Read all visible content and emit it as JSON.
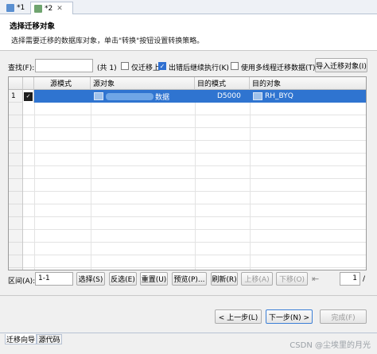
{
  "tabs": [
    {
      "label": "*1"
    },
    {
      "label": "*2",
      "close": "✕"
    }
  ],
  "header": {
    "title": "选择迁移对象",
    "description": "选择需要迁移的数据库对象，单击\"转换\"按钮设置转换策略。"
  },
  "search": {
    "label": "查找(F):",
    "value": "",
    "count": "(共 1)",
    "options": [
      {
        "label": "仅迁移上",
        "checked": false
      },
      {
        "label": "出错后继续执行(K)",
        "checked": true
      },
      {
        "label": "使用多线程迁移数据(T)",
        "checked": false
      }
    ],
    "import_button": "导入迁移对象(I)"
  },
  "table": {
    "columns": [
      "",
      "源模式",
      "源对象",
      "目的模式",
      "目的对象"
    ],
    "rows": [
      {
        "index": "1",
        "checked": true,
        "source_schema": "",
        "source_object": "数据",
        "target_schema": "D5000",
        "target_object": "RH_BYQ"
      }
    ]
  },
  "range": {
    "label": "区间(A):",
    "value": "1-1",
    "buttons": {
      "select": "选择(S)",
      "invert": "反选(E)",
      "reset": "重置(U)",
      "preview": "预览(P)...",
      "refresh": "刷新(R)",
      "up": "上移(A)",
      "down": "下移(O)"
    },
    "page_icon": "⇤",
    "page_value": "1",
    "page_suffix": "/"
  },
  "wizard": {
    "back": "< 上一步(L)",
    "next": "下一步(N) >",
    "finish": "完成(F)"
  },
  "bottom_tabs": [
    {
      "label": "迁移向导"
    },
    {
      "label": "源代码"
    }
  ],
  "watermark": "CSDN @尘埃里的月光",
  "colors": {
    "selection": "#2f74d0",
    "accent": "#5a8fd0"
  }
}
